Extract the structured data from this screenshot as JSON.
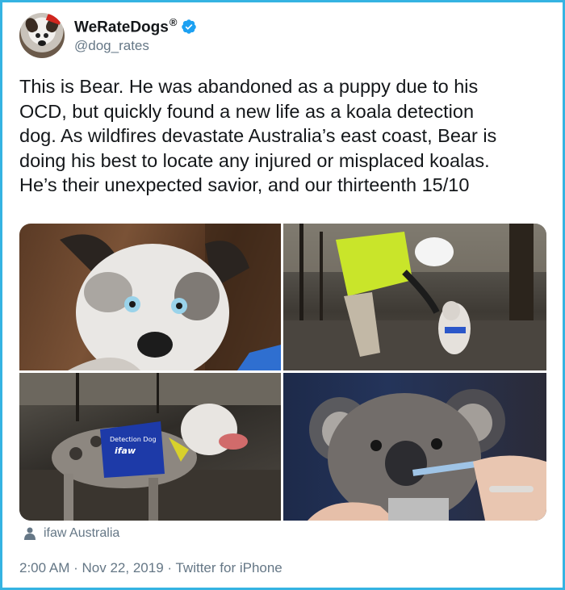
{
  "account": {
    "display_name": "WeRateDogs",
    "registered_mark": "®",
    "handle": "@dog_rates",
    "verified": true,
    "avatar_icon": "dog-avatar"
  },
  "tweet": {
    "text": "This is Bear. He was abandoned as a puppy due to his\nOCD, but quickly found a new life as a koala detection\ndog. As wildfires devastate Australia’s east coast, Bear is\ndoing his best to locate any injured or misplaced koalas.\nHe’s their unexpected savior, and our thirteenth 15/10"
  },
  "media": {
    "photos": [
      {
        "subject": "dog-closeup-photo",
        "vest_text": ""
      },
      {
        "subject": "handler-with-dog-photo",
        "vest_text": ""
      },
      {
        "subject": "dog-in-vest-photo",
        "vest_text": "Detection Dog\nifaw"
      },
      {
        "subject": "koala-drinking-photo",
        "vest_text": ""
      }
    ],
    "credit": "ifaw Australia"
  },
  "meta": {
    "time": "2:00 AM",
    "separator": "·",
    "date": "Nov 22, 2019",
    "source": "Twitter for iPhone"
  },
  "colors": {
    "frame_border": "#35b3e2",
    "verified_blue": "#1da1f2",
    "secondary_text": "#657786"
  }
}
